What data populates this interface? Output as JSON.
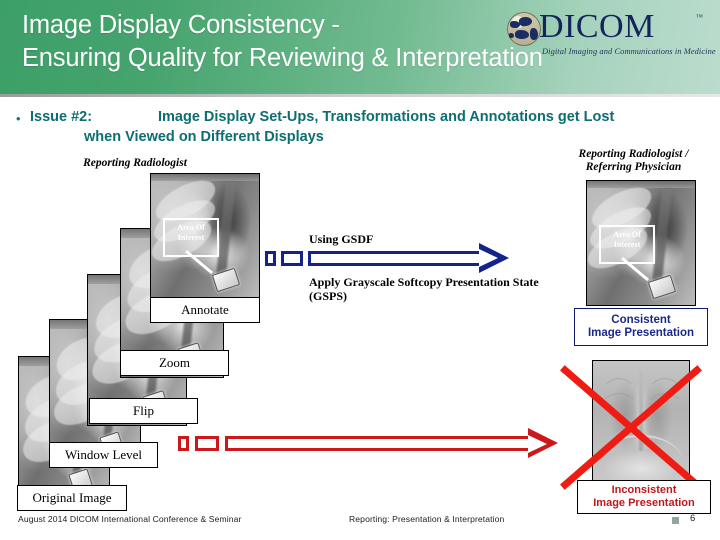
{
  "header": {
    "title_line1": "Image Display Consistency -",
    "title_line2": "Ensuring Quality for Reviewing & Interpretation",
    "logo_word": "DICOM",
    "logo_tm": "™",
    "logo_tagline": "Digital Imaging and Communications in Medicine",
    "bg_from": "#3d9f68",
    "bg_to": "#bcdcce",
    "title_color": "#ffffff"
  },
  "issue": {
    "bullet": "•",
    "label": "Issue #2:",
    "text_line1": "Image Display Set-Ups, Transformations and Annotations get Lost",
    "text_line2": "when Viewed on Different Displays",
    "color": "#0c6e72"
  },
  "left_panel": {
    "caption": "Reporting Radiologist",
    "aoi_label_line1": "Area Of",
    "aoi_label_line2": "Interest",
    "steps": [
      {
        "label": "Annotate"
      },
      {
        "label": "Zoom"
      },
      {
        "label": "Flip"
      },
      {
        "label": "Window Level"
      },
      {
        "label": "Original Image"
      }
    ]
  },
  "middle": {
    "arrow_top_label": "Using GSDF",
    "arrow_bottom_label_line1": "Apply Grayscale Softcopy Presentation State",
    "arrow_bottom_label_line2": "(GSPS)",
    "arrow_top_color": "#14228c",
    "arrow_bottom_color": "#cd1719"
  },
  "right_panel": {
    "caption_line1": "Reporting Radiologist /",
    "caption_line2": "Referring Physician",
    "aoi_label_line1": "Area Of",
    "aoi_label_line2": "Interest",
    "good_result_line1": "Consistent",
    "good_result_line2": "Image Presentation",
    "good_result_color": "#1b2a8a",
    "bad_result_line1": "Inconsistent",
    "bad_result_line2": "Image Presentation",
    "bad_result_color": "#c2171b",
    "cross_color": "#ee1c13"
  },
  "footer": {
    "left": "August 2014 DICOM International Conference & Seminar",
    "center": "Reporting: Presentation & Interpretation",
    "page_number": "6"
  }
}
